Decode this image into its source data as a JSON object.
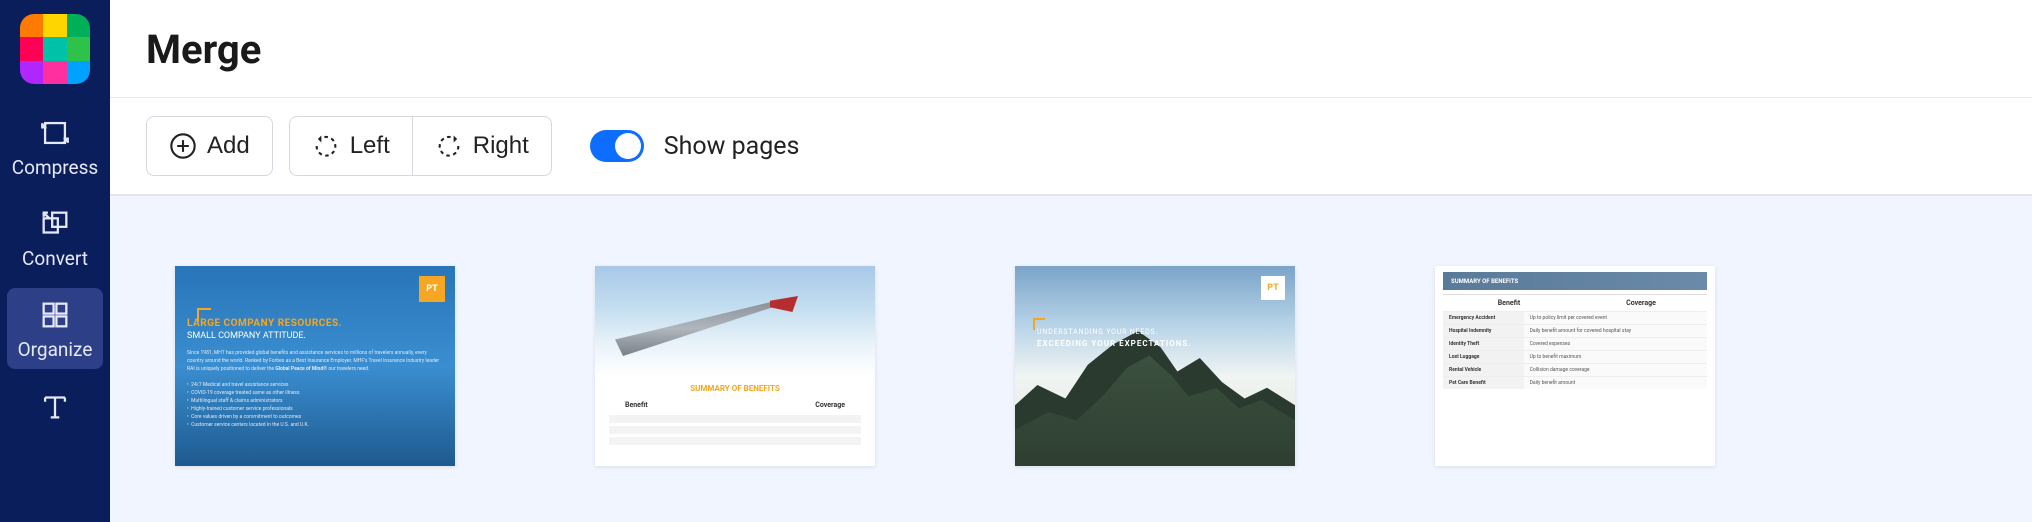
{
  "logo_colors": [
    "#ff7a00",
    "#ffd500",
    "#00b058",
    "#ff0057",
    "#00c2a8",
    "#2ec24b",
    "#b026ff",
    "#ff2fa0",
    "#00a2ff"
  ],
  "sidebar": {
    "items": [
      {
        "label": "Compress",
        "active": false
      },
      {
        "label": "Convert",
        "active": false
      },
      {
        "label": "Organize",
        "active": true
      },
      {
        "label": "",
        "active": false
      }
    ]
  },
  "title": "Merge",
  "toolbar": {
    "add_label": "Add",
    "left_label": "Left",
    "right_label": "Right",
    "show_pages_label": "Show pages",
    "show_pages_on": true
  },
  "pages": [
    {
      "badge": "PT",
      "heading": "LARGE COMPANY RESOURCES.",
      "subheading": "SMALL COMPANY ATTITUDE."
    },
    {
      "summary_title": "SUMMARY OF BENEFITS",
      "col1": "Benefit",
      "col2": "Coverage"
    },
    {
      "badge": "PT",
      "line1": "UNDERSTANDING YOUR NEEDS.",
      "line2": "EXCEEDING YOUR EXPECTATIONS."
    },
    {
      "header": "SUMMARY OF BENEFITS",
      "col1": "Benefit",
      "col2": "Coverage"
    }
  ]
}
